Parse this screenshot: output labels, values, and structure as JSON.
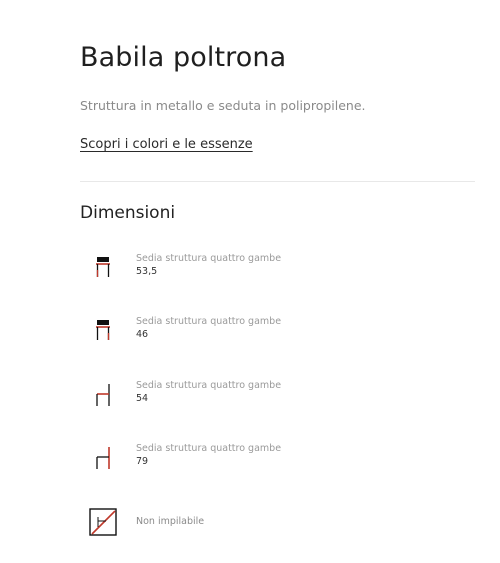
{
  "product": {
    "title": "Babila poltrona",
    "description": "Struttura in metallo e seduta in polipropilene.",
    "link_label": "Scopri i colori e le essenze"
  },
  "dimensions": {
    "heading": "Dimensioni",
    "items": [
      {
        "icon": "chair-seat-height-icon",
        "label": "Sedia struttura quattro gambe",
        "value": "53,5"
      },
      {
        "icon": "chair-seat-height-icon",
        "label": "Sedia struttura quattro gambe",
        "value": "46"
      },
      {
        "icon": "chair-side-depth-icon",
        "label": "Sedia struttura quattro gambe",
        "value": "54"
      },
      {
        "icon": "chair-side-height-icon",
        "label": "Sedia struttura quattro gambe",
        "value": "79"
      }
    ],
    "stacking": {
      "icon": "not-stackable-icon",
      "label": "Non impilabile"
    }
  },
  "colors": {
    "accent": "#c0392b",
    "text": "#222222",
    "muted": "#9a9a9a",
    "divider": "#e8e8e8"
  }
}
